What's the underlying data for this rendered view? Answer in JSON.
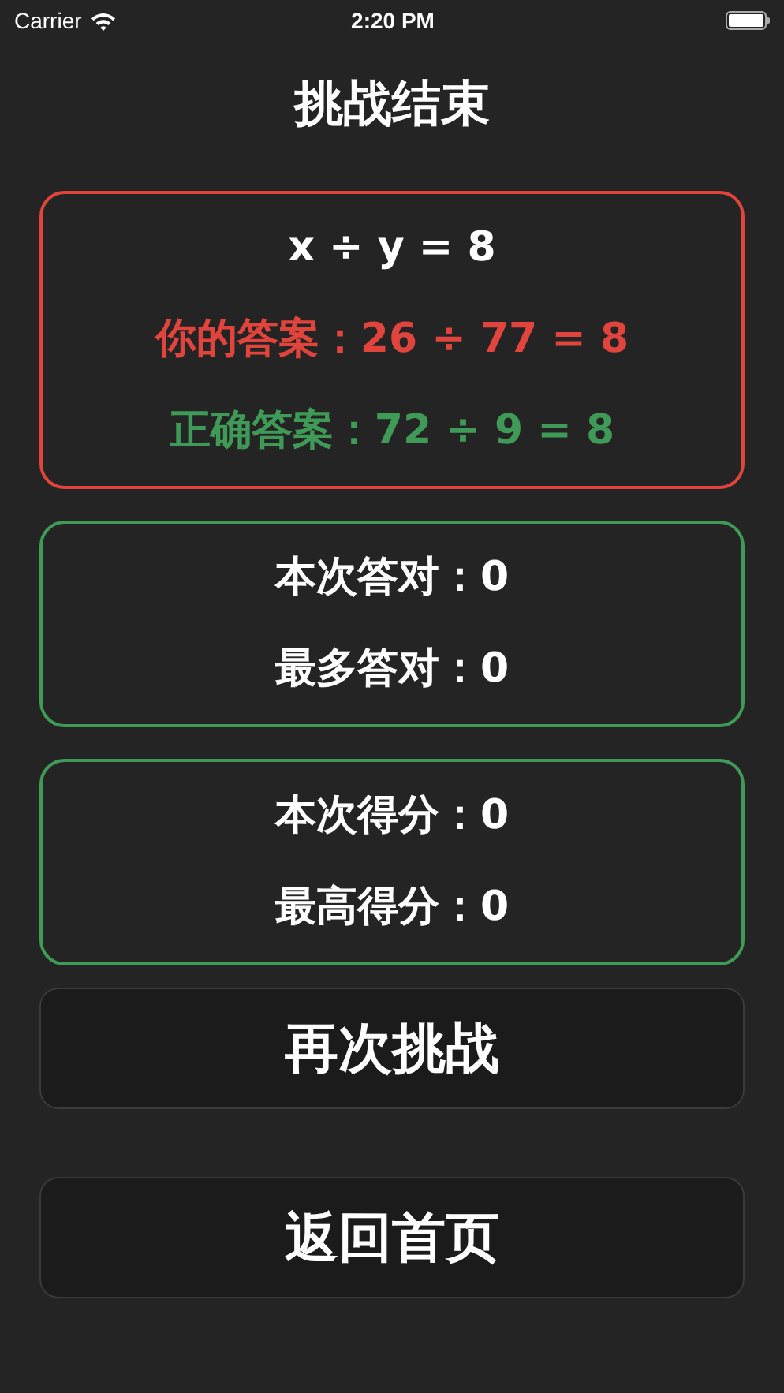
{
  "status_bar": {
    "carrier": "Carrier",
    "time": "2:20 PM"
  },
  "title": "挑战结束",
  "cards": [
    {
      "color": "#e0443c",
      "lines": [
        {
          "kind": "plain",
          "text": "x ÷ y = 8"
        },
        {
          "kind": "wrong",
          "text": "你的答案：26 ÷ 77 = 8"
        },
        {
          "kind": "correct",
          "text": "正确答案：72 ÷ 9 = 8"
        }
      ]
    },
    {
      "color": "#3e9a56",
      "lines": [
        {
          "kind": "plain",
          "text": "本次答对：0"
        },
        {
          "kind": "plain",
          "text": "最多答对：0"
        }
      ]
    },
    {
      "color": "#3e9a56",
      "lines": [
        {
          "kind": "plain",
          "text": "本次得分：0"
        },
        {
          "kind": "plain",
          "text": "最高得分：0"
        }
      ]
    }
  ],
  "buttons": [
    "再次挑战",
    "返回首页"
  ]
}
